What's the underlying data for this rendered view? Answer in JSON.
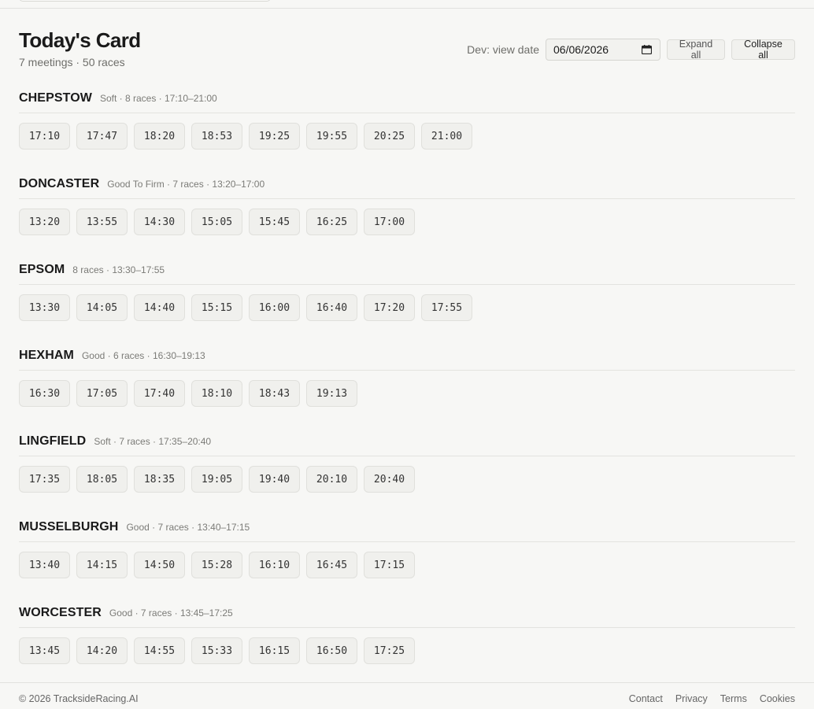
{
  "header": {
    "title": "Today's Card",
    "subtitle": "7 meetings · 50 races"
  },
  "controls": {
    "dev_label": "Dev: view date",
    "date_value": "06/06/2026",
    "expand_label": "Expand all",
    "collapse_label": "Collapse all"
  },
  "meetings": [
    {
      "name": "CHEPSTOW",
      "meta": "Soft · 8 races · 17:10–21:00",
      "races": [
        "17:10",
        "17:47",
        "18:20",
        "18:53",
        "19:25",
        "19:55",
        "20:25",
        "21:00"
      ]
    },
    {
      "name": "DONCASTER",
      "meta": "Good To Firm · 7 races · 13:20–17:00",
      "races": [
        "13:20",
        "13:55",
        "14:30",
        "15:05",
        "15:45",
        "16:25",
        "17:00"
      ]
    },
    {
      "name": "EPSOM",
      "meta": "8 races · 13:30–17:55",
      "races": [
        "13:30",
        "14:05",
        "14:40",
        "15:15",
        "16:00",
        "16:40",
        "17:20",
        "17:55"
      ]
    },
    {
      "name": "HEXHAM",
      "meta": "Good · 6 races · 16:30–19:13",
      "races": [
        "16:30",
        "17:05",
        "17:40",
        "18:10",
        "18:43",
        "19:13"
      ]
    },
    {
      "name": "LINGFIELD",
      "meta": "Soft · 7 races · 17:35–20:40",
      "races": [
        "17:35",
        "18:05",
        "18:35",
        "19:05",
        "19:40",
        "20:10",
        "20:40"
      ]
    },
    {
      "name": "MUSSELBURGH",
      "meta": "Good · 7 races · 13:40–17:15",
      "races": [
        "13:40",
        "14:15",
        "14:50",
        "15:28",
        "16:10",
        "16:45",
        "17:15"
      ]
    },
    {
      "name": "WORCESTER",
      "meta": "Good · 7 races · 13:45–17:25",
      "races": [
        "13:45",
        "14:20",
        "14:55",
        "15:33",
        "16:15",
        "16:50",
        "17:25"
      ]
    }
  ],
  "footer": {
    "copyright": "© 2026 TracksideRacing.AI",
    "links": [
      "Contact",
      "Privacy",
      "Terms",
      "Cookies"
    ]
  },
  "icons": {
    "calendar": "calendar-icon"
  }
}
